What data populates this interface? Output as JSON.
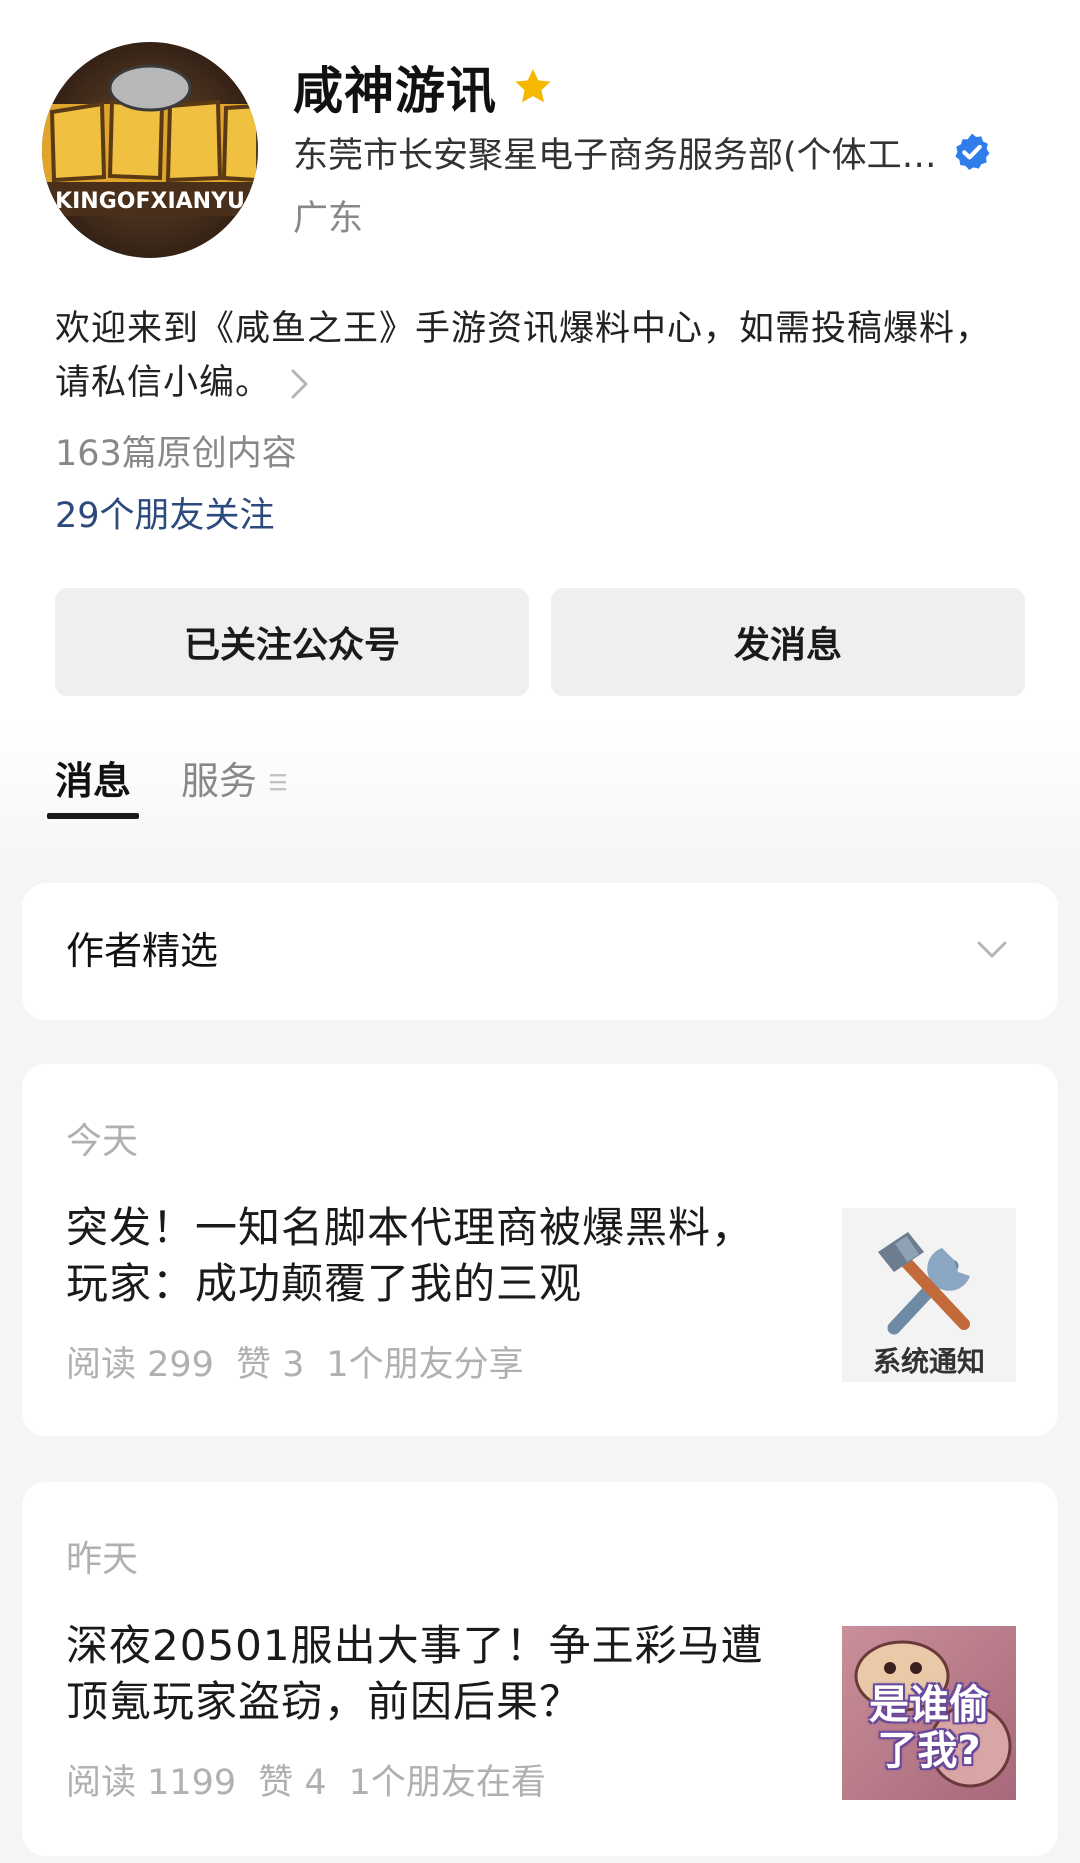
{
  "profile": {
    "name": "咸神游讯",
    "company": "东莞市长安聚星电子商务服务部(个体工…",
    "region": "广东",
    "avatar_text": "KINGOFXIANYU",
    "intro_line1": "欢迎来到《咸鱼之王》手游资讯爆料中心，如需投稿爆料，",
    "intro_line2": "请私信小编。",
    "original_count": "163篇原创内容",
    "friends_follow": "29个朋友关注"
  },
  "buttons": {
    "followed": "已关注公众号",
    "message": "发消息"
  },
  "tabs": {
    "messages": "消息",
    "services": "服务"
  },
  "selection": {
    "title": "作者精选"
  },
  "articles": [
    {
      "date": "今天",
      "title_line1": "突发！一知名脚本代理商被爆黑料，",
      "title_line2": "玩家：成功颠覆了我的三观",
      "reads": "阅读 299",
      "likes": "赞 3",
      "social": "1个朋友分享",
      "thumb_caption": "系统通知",
      "thumb_icon": "hammer-wrench-icon"
    },
    {
      "date": "昨天",
      "title_line1": "深夜20501服出大事了！争王彩马遭",
      "title_line2": "顶氪玩家盗窃，前因后果？",
      "reads": "阅读 1199",
      "likes": "赞 4",
      "social": "1个朋友在看",
      "thumb_text_line1": "是谁偷",
      "thumb_text_line2": "了我?"
    }
  ],
  "colors": {
    "star": "#f5b800",
    "verified": "#2f7dea",
    "friends_link": "#2c4a7c",
    "button_bg": "#efefef",
    "page_bg": "#f5f5f5"
  }
}
